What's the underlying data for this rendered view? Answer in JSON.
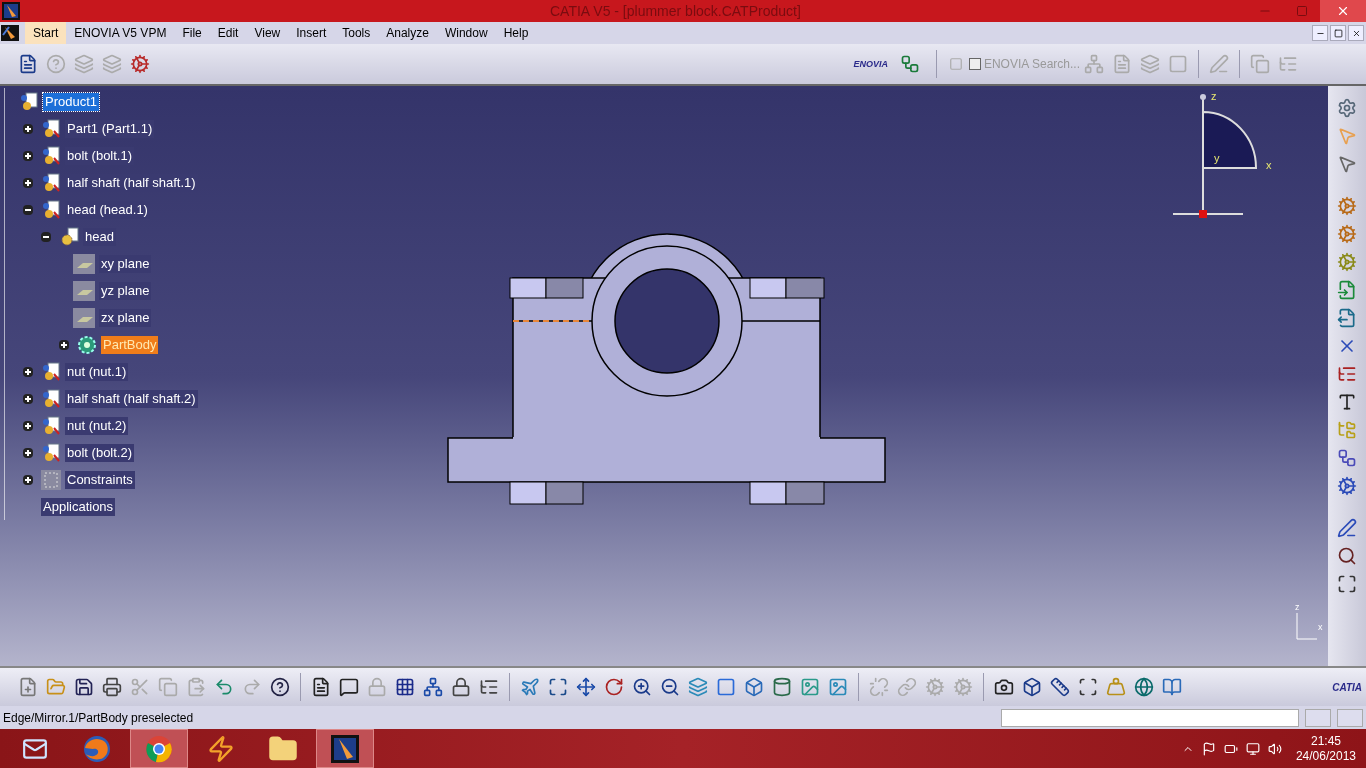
{
  "window": {
    "title": "CATIA V5 - [plummer block.CATProduct]"
  },
  "menu": [
    {
      "label": "Start",
      "selected": true
    },
    {
      "label": "ENOVIA V5 VPM",
      "selected": false
    },
    {
      "label": "File",
      "selected": false
    },
    {
      "label": "Edit",
      "selected": false
    },
    {
      "label": "View",
      "selected": false
    },
    {
      "label": "Insert",
      "selected": false
    },
    {
      "label": "Tools",
      "selected": false
    },
    {
      "label": "Analyze",
      "selected": false
    },
    {
      "label": "Window",
      "selected": false
    },
    {
      "label": "Help",
      "selected": false
    }
  ],
  "toolbar": {
    "enovia_logo": "ENOVIA",
    "search": {
      "label": "ENOVIA Search...",
      "checked": false
    }
  },
  "tree": [
    {
      "label": "Product1",
      "kind": "product",
      "selected": true,
      "preselected": false,
      "children": [
        {
          "label": "Part1 (Part1.1)",
          "kind": "part",
          "selected": false,
          "preselected": false,
          "expanded": false
        },
        {
          "label": "bolt (bolt.1)",
          "kind": "part",
          "selected": false,
          "preselected": false,
          "expanded": false
        },
        {
          "label": "half shaft (half shaft.1)",
          "kind": "part",
          "selected": false,
          "preselected": false,
          "expanded": false
        },
        {
          "label": "head (head.1)",
          "kind": "part",
          "selected": false,
          "preselected": false,
          "expanded": true,
          "children": [
            {
              "label": "head",
              "kind": "body-part",
              "selected": false,
              "preselected": false,
              "expanded": true,
              "children": [
                {
                  "label": "xy plane",
                  "kind": "plane",
                  "selected": false,
                  "preselected": false
                },
                {
                  "label": "yz plane",
                  "kind": "plane",
                  "selected": false,
                  "preselected": false
                },
                {
                  "label": "zx plane",
                  "kind": "plane",
                  "selected": false,
                  "preselected": false
                },
                {
                  "label": "PartBody",
                  "kind": "body",
                  "selected": false,
                  "preselected": true,
                  "expanded": false
                }
              ]
            }
          ]
        },
        {
          "label": "nut (nut.1)",
          "kind": "part",
          "selected": false,
          "preselected": false,
          "expanded": false
        },
        {
          "label": "half shaft (half shaft.2)",
          "kind": "part",
          "selected": false,
          "preselected": false,
          "expanded": false
        },
        {
          "label": "nut (nut.2)",
          "kind": "part",
          "selected": false,
          "preselected": false,
          "expanded": false
        },
        {
          "label": "bolt (bolt.2)",
          "kind": "part",
          "selected": false,
          "preselected": false,
          "expanded": false
        },
        {
          "label": "Constraints",
          "kind": "constraints",
          "selected": false,
          "preselected": false,
          "expanded": false
        },
        {
          "label": "Applications",
          "kind": "applications",
          "selected": false,
          "preselected": false
        }
      ]
    }
  ],
  "compass": {
    "labels": [
      "z",
      "y",
      "x"
    ]
  },
  "axis_triad": {
    "labels": [
      "z",
      "x"
    ]
  },
  "catia_logo": "CATIA",
  "status_bar": {
    "message": "Edge/Mirror.1/PartBody preselected"
  },
  "taskbar": {
    "apps": [
      {
        "kind": "mail",
        "selected": false
      },
      {
        "kind": "firefox",
        "selected": false
      },
      {
        "kind": "chrome",
        "selected": true
      },
      {
        "kind": "player",
        "selected": false
      },
      {
        "kind": "folder",
        "selected": false
      },
      {
        "kind": "catia",
        "selected": true
      }
    ],
    "time": "21:45",
    "date": "24/06/2013"
  }
}
